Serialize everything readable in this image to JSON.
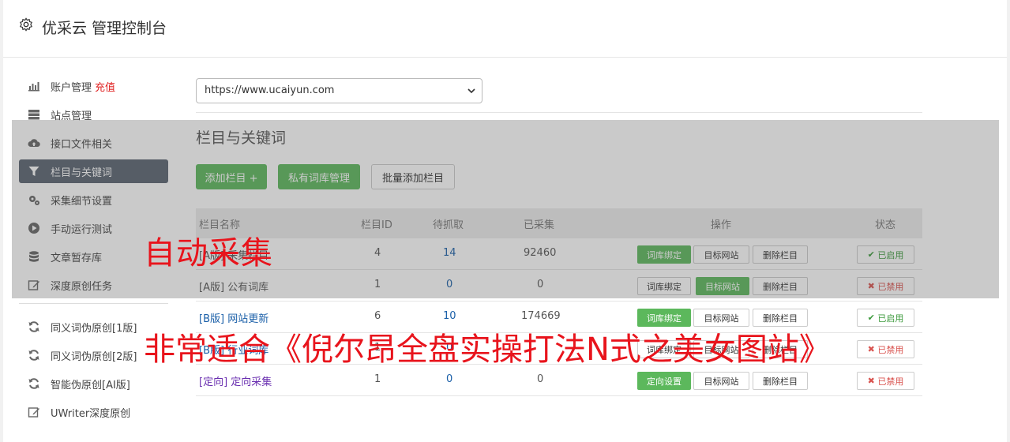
{
  "header": {
    "title": "优采云 管理控制台",
    "icon": "gear-icon"
  },
  "sidebar": {
    "items": [
      {
        "label": "账户管理",
        "extra": "充值",
        "icon": "bar-chart-icon"
      },
      {
        "label": "站点管理",
        "icon": "server-icon"
      },
      {
        "label": "接口文件相关",
        "icon": "cloud-upload-icon"
      },
      {
        "label": "栏目与关键词",
        "icon": "filter-icon",
        "active": true
      },
      {
        "label": "采集细节设置",
        "icon": "cogs-icon"
      },
      {
        "label": "手动运行测试",
        "icon": "play-circle-icon"
      },
      {
        "label": "文章暂存库",
        "icon": "database-icon"
      },
      {
        "label": "深度原创任务",
        "icon": "edit-icon"
      }
    ],
    "tools": [
      {
        "label": "同义词伪原创[1版]",
        "icon": "refresh-icon"
      },
      {
        "label": "同义词伪原创[2版]",
        "icon": "refresh-icon"
      },
      {
        "label": "智能伪原创[AI版]",
        "icon": "refresh-icon"
      },
      {
        "label": "UWriter深度原创",
        "icon": "edit-icon"
      }
    ]
  },
  "site_select": {
    "value": "https://www.ucaiyun.com"
  },
  "section": {
    "title": "栏目与关键词",
    "add_button": "添加栏目 +",
    "private_lib_button": "私有词库管理",
    "batch_add_button": "批量添加栏目"
  },
  "table": {
    "headers": [
      "栏目名称",
      "栏目ID",
      "待抓取",
      "已采集",
      "操作",
      "状态"
    ],
    "rows": [
      {
        "name": "[A版] 采集栏目",
        "id": "4",
        "pending": "14",
        "collected": "92460",
        "op1": "词库绑定",
        "op2": "目标网站",
        "op3": "删除栏目",
        "status": "已启用"
      },
      {
        "name": "[A版] 公有词库",
        "id": "1",
        "pending": "0",
        "collected": "0",
        "op1": "词库绑定",
        "op2": "目标网站",
        "op3": "删除栏目",
        "status": "已禁用"
      },
      {
        "name": "[B版] 网站更新",
        "id": "6",
        "pending": "10",
        "collected": "174669",
        "op1": "词库绑定",
        "op2": "目标网站",
        "op3": "删除栏目",
        "status": "已启用"
      },
      {
        "name": "[B版] 行业词库",
        "id": "1",
        "pending": "0",
        "collected": "",
        "op1": "词库绑定",
        "op2": "目标网站",
        "op3": "删除栏目",
        "status": "已禁用"
      },
      {
        "name": "[定向] 定向采集",
        "id": "1",
        "pending": "0",
        "collected": "0",
        "op1": "定向设置",
        "op2": "目标网站",
        "op3": "删除栏目",
        "status": "已禁用"
      }
    ]
  },
  "watermark": {
    "line1": "自动采集",
    "line2": "非常适合《倪尔昂全盘实操打法N式之美女图站》"
  },
  "colors": {
    "green": "#5cb85c",
    "active_nav": "#5a6370",
    "watermark": "#e8141c",
    "link_blue": "#1a5fa8"
  }
}
